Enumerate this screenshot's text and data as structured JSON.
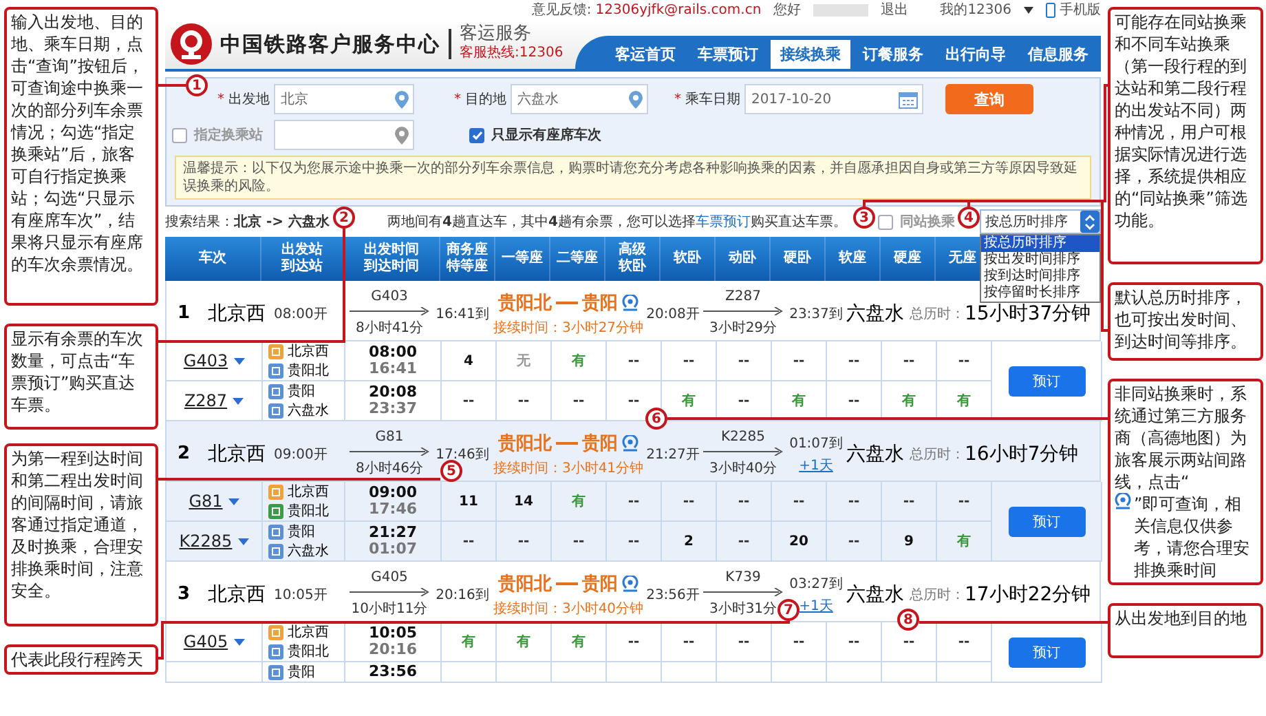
{
  "left_notes": [
    {
      "text": "输入出发地、目的地、乘车日期，点击“查询”按钮后，可查询途中换乘一次的部分列车余票情况；勾选“指定换乘站”后，旅客可自行指定换乘站；勾选“只显示有座席车次”，结果将只显示有座席的车次余票情况。"
    },
    {
      "text": "显示有余票的车次数量，可点击“车票预订”购买直达车票。"
    },
    {
      "text": "为第一程到达时间和第二程出发时间的间隔时间，请旅客通过指定通道，及时换乘，合理安排换乘时间，注意安全。"
    },
    {
      "text": "代表此段行程跨天"
    }
  ],
  "top_bar": {
    "feedback_label": "意见反馈:",
    "feedback_email": "12306yjfk@rails.com.cn",
    "greeting": "您好",
    "logout": "退出",
    "account": "我的12306",
    "mobile": "手机版"
  },
  "header": {
    "title": "中国铁路客户服务中心",
    "subtitle": "客运服务",
    "hotline": "客服热线:12306"
  },
  "nav": [
    {
      "label": "客运首页",
      "selected": false
    },
    {
      "label": "车票预订",
      "selected": false
    },
    {
      "label": "接续换乘",
      "selected": true
    },
    {
      "label": "订餐服务",
      "selected": false
    },
    {
      "label": "出行向导",
      "selected": false
    },
    {
      "label": "信息服务",
      "selected": false
    }
  ],
  "search": {
    "from": {
      "mark": "*",
      "label": "出发地",
      "value": "北京"
    },
    "to": {
      "mark": "*",
      "label": "目的地",
      "value": "六盘水"
    },
    "date": {
      "mark": "*",
      "label": "乘车日期",
      "value": "2017-10-20"
    },
    "submit": "查询",
    "transfer_station": {
      "checked": false,
      "label": "指定换乘站"
    },
    "seats_only": {
      "checked": true,
      "label": "只显示有座席车次"
    },
    "notice": "温馨提示：以下仅为您展示途中换乘一次的部分列车余票信息，购票时请您充分考虑各种影响换乘的因素，并自愿承担因自身或第三方等原因导致延误换乘的风险。"
  },
  "results": {
    "label": "搜索结果：",
    "route": "北京 -> 六盘水",
    "summary_before": "两地间有**4**趟直达车，其中**4**趟有余票，您可以选择",
    "link": "车票预订",
    "summary_after": "购买直达车票。",
    "same_station": {
      "checked": false,
      "label": "同站换乘"
    },
    "sort": {
      "value": "按总历时排序",
      "options": [
        {
          "label": "按总历时排序",
          "selected": true
        },
        {
          "label": "按出发时间排序",
          "selected": false
        },
        {
          "label": "按到达时间排序",
          "selected": false
        },
        {
          "label": "按停留时长排序",
          "selected": false
        }
      ]
    }
  },
  "table": {
    "columns": [
      "车次",
      "出发站到达站",
      "出发时间到达时间",
      "商务座特等座",
      "一等座",
      "二等座",
      "高级软卧",
      "软卧",
      "动卧",
      "硬卧",
      "软座",
      "硬座",
      "无座"
    ],
    "groups": [
      {
        "index": "1",
        "depart_station": "北京西",
        "depart_time": "08:00开",
        "leg1": {
          "train": "G403",
          "duration": "8小时41分"
        },
        "mid_arrive": "16:41到",
        "transfer": {
          "from": "贵阳北",
          "to": "贵阳",
          "wait": "接续时间：3小时27分钟"
        },
        "mid_depart": "20:08开",
        "leg2": {
          "train": "Z287",
          "duration": "3小时29分"
        },
        "arrive": "23:37到",
        "destination": "六盘水",
        "total_label": "总历时：",
        "total": "15小时37分钟",
        "book": "预订",
        "legs": [
          {
            "train": "G403",
            "stations": [
              {
                "kind": "start",
                "name": "北京西"
              },
              {
                "kind": "pass",
                "name": "贵阳北"
              }
            ],
            "depart": "08:00",
            "arrive": "16:41",
            "seats": [
              {
                "text": "4",
                "kind": "count"
              },
              {
                "text": "无",
                "kind": "none"
              },
              {
                "text": "有",
                "kind": "yes"
              },
              {
                "text": "--",
                "kind": "dash"
              },
              {
                "text": "--",
                "kind": "dash"
              },
              {
                "text": "--",
                "kind": "dash"
              },
              {
                "text": "--",
                "kind": "dash"
              },
              {
                "text": "--",
                "kind": "dash"
              },
              {
                "text": "--",
                "kind": "dash"
              },
              {
                "text": "--",
                "kind": "dash"
              }
            ]
          },
          {
            "train": "Z287",
            "stations": [
              {
                "kind": "pass",
                "name": "贵阳"
              },
              {
                "kind": "pass",
                "name": "六盘水"
              }
            ],
            "depart": "20:08",
            "arrive": "23:37",
            "seats": [
              {
                "text": "--",
                "kind": "dash"
              },
              {
                "text": "--",
                "kind": "dash"
              },
              {
                "text": "--",
                "kind": "dash"
              },
              {
                "text": "--",
                "kind": "dash"
              },
              {
                "text": "有",
                "kind": "yes"
              },
              {
                "text": "--",
                "kind": "dash"
              },
              {
                "text": "有",
                "kind": "yes"
              },
              {
                "text": "--",
                "kind": "dash"
              },
              {
                "text": "有",
                "kind": "yes"
              },
              {
                "text": "有",
                "kind": "yes"
              }
            ]
          }
        ]
      },
      {
        "index": "2",
        "depart_station": "北京西",
        "depart_time": "09:00开",
        "leg1": {
          "train": "G81",
          "duration": "8小时46分"
        },
        "mid_arrive": "17:46到",
        "transfer": {
          "from": "贵阳北",
          "to": "贵阳",
          "wait": "接续时间：3小时41分钟"
        },
        "mid_depart": "21:27开",
        "leg2": {
          "train": "K2285",
          "duration": "3小时40分"
        },
        "arrive": "01:07到",
        "next_day": "+1天",
        "destination": "六盘水",
        "total_label": "总历时：",
        "total": "16小时7分钟",
        "book": "预订",
        "legs": [
          {
            "train": "G81",
            "stations": [
              {
                "kind": "start",
                "name": "北京西"
              },
              {
                "kind": "end",
                "name": "贵阳北"
              }
            ],
            "depart": "09:00",
            "arrive": "17:46",
            "seats": [
              {
                "text": "11",
                "kind": "count"
              },
              {
                "text": "14",
                "kind": "count"
              },
              {
                "text": "有",
                "kind": "yes"
              },
              {
                "text": "--",
                "kind": "dash"
              },
              {
                "text": "--",
                "kind": "dash"
              },
              {
                "text": "--",
                "kind": "dash"
              },
              {
                "text": "--",
                "kind": "dash"
              },
              {
                "text": "--",
                "kind": "dash"
              },
              {
                "text": "--",
                "kind": "dash"
              },
              {
                "text": "--",
                "kind": "dash"
              }
            ]
          },
          {
            "train": "K2285",
            "stations": [
              {
                "kind": "pass",
                "name": "贵阳"
              },
              {
                "kind": "pass",
                "name": "六盘水"
              }
            ],
            "depart": "21:27",
            "arrive": "01:07",
            "seats": [
              {
                "text": "--",
                "kind": "dash"
              },
              {
                "text": "--",
                "kind": "dash"
              },
              {
                "text": "--",
                "kind": "dash"
              },
              {
                "text": "--",
                "kind": "dash"
              },
              {
                "text": "2",
                "kind": "count"
              },
              {
                "text": "--",
                "kind": "dash"
              },
              {
                "text": "20",
                "kind": "count"
              },
              {
                "text": "--",
                "kind": "dash"
              },
              {
                "text": "9",
                "kind": "count"
              },
              {
                "text": "有",
                "kind": "yes"
              }
            ]
          }
        ]
      },
      {
        "index": "3",
        "depart_station": "北京西",
        "depart_time": "10:05开",
        "leg1": {
          "train": "G405",
          "duration": "10小时11分"
        },
        "mid_arrive": "20:16到",
        "transfer": {
          "from": "贵阳北",
          "to": "贵阳",
          "wait": "接续时间：3小时40分钟"
        },
        "mid_depart": "23:56开",
        "leg2": {
          "train": "K739",
          "duration": "3小时31分"
        },
        "arrive": "03:27到",
        "next_day": "+1天",
        "destination": "六盘水",
        "total_label": "总历时：",
        "total": "17小时22分钟",
        "book": "预订",
        "legs": [
          {
            "train": "G405",
            "stations": [
              {
                "kind": "start",
                "name": "北京西"
              },
              {
                "kind": "pass",
                "name": "贵阳北"
              }
            ],
            "depart": "10:05",
            "arrive": "20:16",
            "seats": [
              {
                "text": "有",
                "kind": "yes"
              },
              {
                "text": "有",
                "kind": "yes"
              },
              {
                "text": "有",
                "kind": "yes"
              },
              {
                "text": "--",
                "kind": "dash"
              },
              {
                "text": "--",
                "kind": "dash"
              },
              {
                "text": "--",
                "kind": "dash"
              },
              {
                "text": "--",
                "kind": "dash"
              },
              {
                "text": "--",
                "kind": "dash"
              },
              {
                "text": "--",
                "kind": "dash"
              },
              {
                "text": "--",
                "kind": "dash"
              }
            ]
          },
          {
            "stations": [
              {
                "kind": "pass",
                "name": "贵阳"
              }
            ],
            "depart": "23:56"
          }
        ]
      }
    ]
  },
  "right_notes": [
    {
      "parts": [
        "可能存在同站换乘和不同车站换乘（第一段行程的到达站和第二段行程的出发站不同）两种情况，用户可根据实际情况进行选择，系统提供相应的“同站换乘”筛选功能。"
      ]
    },
    {
      "parts": [
        "默认总历时排序，也可按出发时间、到达时间等排序。"
      ]
    },
    {
      "parts": [
        "非同站换乘时，系统通过第三方服务商（高德地图）为旅客展示两站间路线，点击“",
        "”即可查询，相关信息仅供参考，请您合理安排换乘时间"
      ]
    },
    {
      "parts": [
        "从出发地到目的地"
      ]
    }
  ],
  "callouts": [
    "1",
    "2",
    "3",
    "4",
    "5",
    "6",
    "7",
    "8"
  ]
}
